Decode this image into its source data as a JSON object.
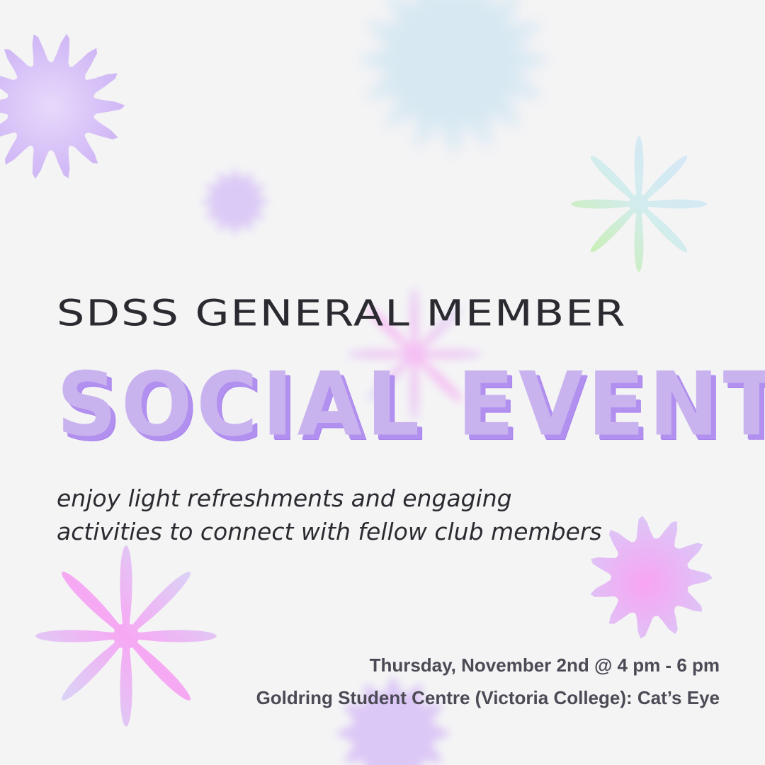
{
  "event": {
    "title": "SDSS GENERAL MEMBER",
    "headline": "SOCIAL EVENT",
    "tagline_line1": "enjoy light refreshments and engaging",
    "tagline_line2": "activities to connect with fellow club members",
    "date_time": "Thursday, November 2nd @ 4 pm - 6 pm",
    "location": "Goldring Student Centre (Victoria College): Cat’s Eye"
  },
  "colors": {
    "background": "#f4f4f5",
    "headline_fill": "#c9b3ee",
    "headline_shadow": "#b290ef",
    "title_text": "#2b2a30",
    "details_text": "#4c4a55",
    "star_purple": "#d9c5f7",
    "star_blue": "#d8e9f3",
    "star_pink": "#f5a9f2",
    "star_green": "#c9efa6"
  },
  "decorations": [
    "starburst-icon",
    "blurred-starburst-icon",
    "eight-point-star-icon",
    "pink-star-icon",
    "pink-starburst-icon"
  ]
}
